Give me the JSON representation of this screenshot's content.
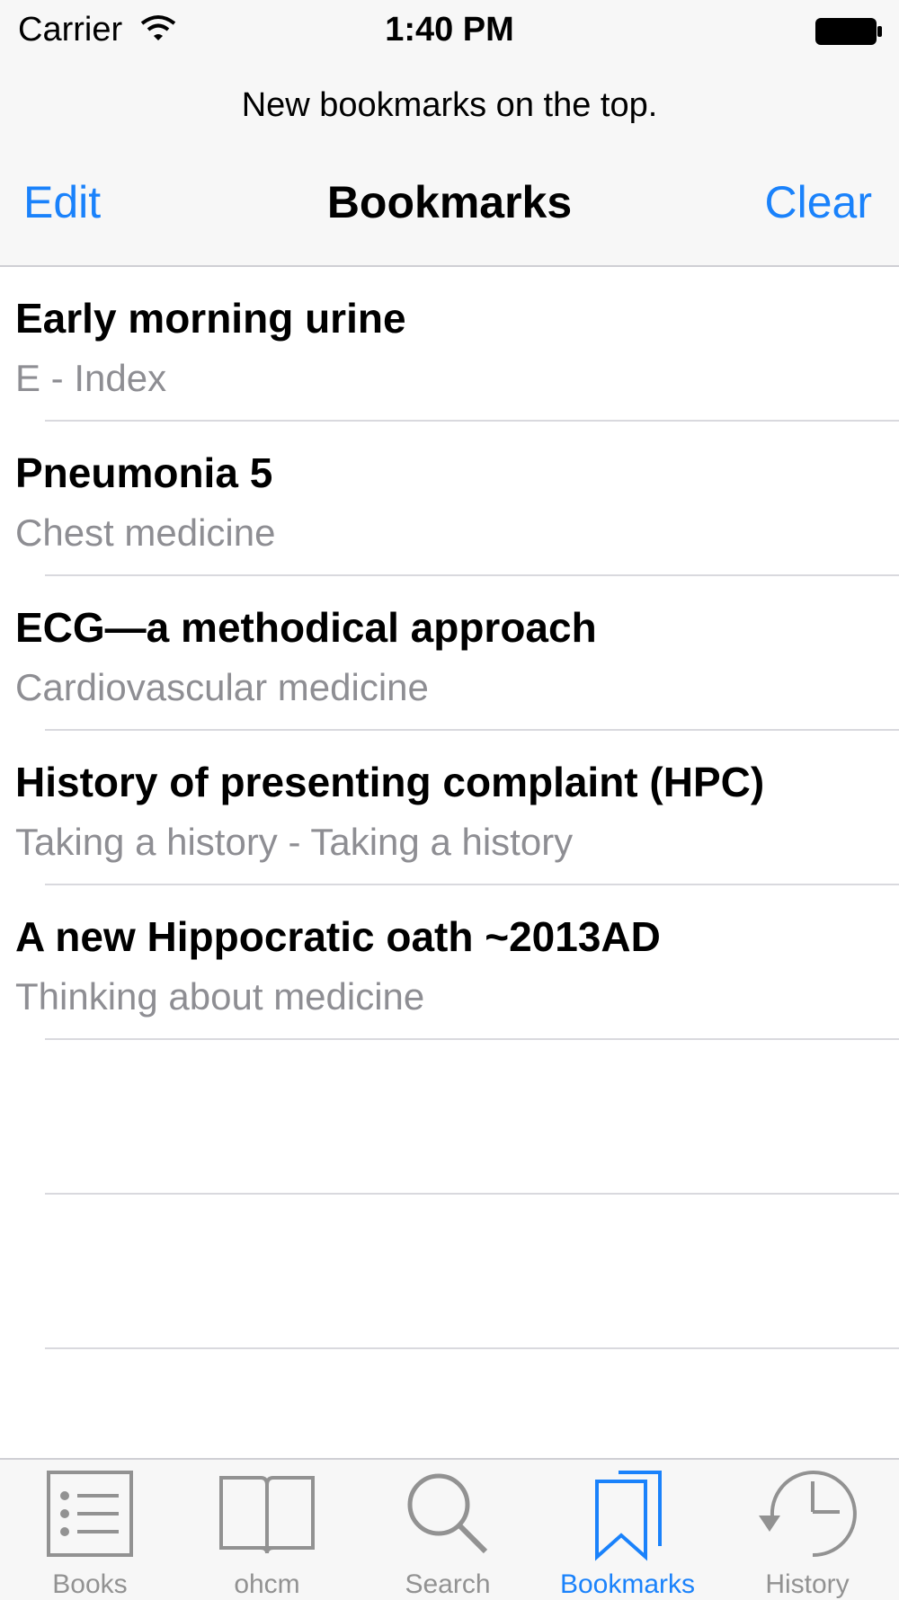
{
  "status_bar": {
    "carrier": "Carrier",
    "time": "1:40 PM"
  },
  "header": {
    "prompt": "New bookmarks on the top.",
    "edit_label": "Edit",
    "title": "Bookmarks",
    "clear_label": "Clear"
  },
  "bookmarks": [
    {
      "title": "Early morning urine",
      "subtitle": "E - Index"
    },
    {
      "title": "Pneumonia 5",
      "subtitle": "Chest medicine"
    },
    {
      "title": "ECG—a methodical approach",
      "subtitle": "Cardiovascular medicine"
    },
    {
      "title": "History of presenting complaint (HPC)",
      "subtitle": "Taking a history - Taking a history"
    },
    {
      "title": "A new Hippocratic oath ~2013AD",
      "subtitle": "Thinking about medicine"
    }
  ],
  "tabs": [
    {
      "label": "Books",
      "icon": "list-icon"
    },
    {
      "label": "ohcm",
      "icon": "open-book-icon"
    },
    {
      "label": "Search",
      "icon": "magnifier-icon"
    },
    {
      "label": "Bookmarks",
      "icon": "bookmarks-icon",
      "active": true
    },
    {
      "label": "History",
      "icon": "clock-history-icon"
    }
  ],
  "colors": {
    "accent": "#1a82fb",
    "inactive": "#929292",
    "subtitle": "#8e8e93",
    "bar_bg": "#f7f7f7"
  }
}
